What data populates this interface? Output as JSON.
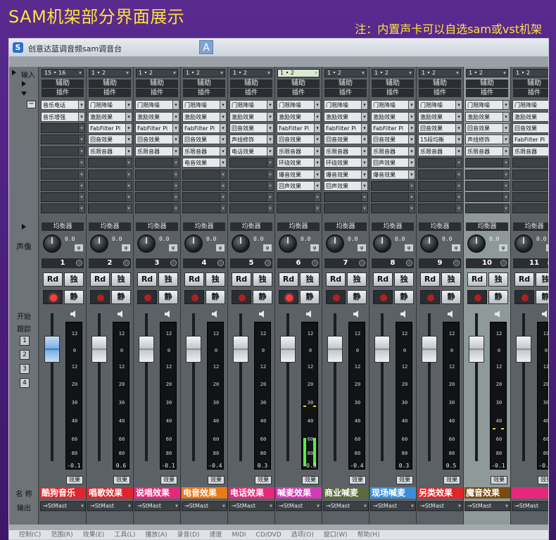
{
  "headline": "SAM机架部分界面展示",
  "note": "注：内置声卡可以自选sam或vst机架",
  "window": {
    "icon_letter": "S",
    "title": "创意达蓝调音频sam调音台"
  },
  "left_labels": {
    "input": "输入",
    "pan": "声像",
    "start": "开始",
    "track": "跟踪",
    "buttons": [
      "1",
      "2",
      "3",
      "4"
    ],
    "name": "名 称",
    "output": "输出"
  },
  "common": {
    "aux": "辅助",
    "plugins": "插件",
    "eq": "均衡器",
    "rd": "Rd",
    "solo": "独",
    "mute": "静",
    "fx": "效果",
    "output": "StMast",
    "pan_value": "0.0",
    "phase": "φ",
    "scale": [
      "12",
      "0",
      "12",
      "20",
      "30",
      "40",
      "60",
      "80"
    ]
  },
  "channels": [
    {
      "number": "1",
      "input": "15 • 16",
      "name": "酷狗音乐",
      "name_color": "#e0252b",
      "volume": "-0.1",
      "fader_pos": 0.17,
      "meter": 0,
      "selected": false,
      "rec": true,
      "blue": true,
      "slots": [
        "音乐电话",
        "音乐增强",
        "",
        "",
        "",
        "",
        "",
        "",
        "",
        ""
      ]
    },
    {
      "number": "2",
      "input": "1 • 2",
      "name": "唱歌效果",
      "name_color": "#e0252b",
      "volume": "0.6",
      "fader_pos": 0.17,
      "meter": 0,
      "selected": false,
      "rec": false,
      "blue": false,
      "slots": [
        "门限降噪",
        "激励效果",
        "FabFilter Pi",
        "回音效果",
        "乐限音器",
        "",
        "",
        "",
        "",
        ""
      ]
    },
    {
      "number": "3",
      "input": "1 • 2",
      "name": "说唱效果",
      "name_color": "#e6287a",
      "volume": "-0.1",
      "fader_pos": 0.17,
      "meter": 0,
      "selected": false,
      "rec": false,
      "blue": false,
      "slots": [
        "门限降噪",
        "激励效果",
        "FabFilter Pi",
        "回音效果",
        "乐限音器",
        "",
        "",
        "",
        "",
        ""
      ]
    },
    {
      "number": "4",
      "input": "1 • 2",
      "name": "电音效果",
      "name_color": "#ea7a16",
      "volume": "-0.4",
      "fader_pos": 0.17,
      "meter": 0,
      "selected": false,
      "rec": false,
      "blue": false,
      "slots": [
        "门限降噪",
        "激励效果",
        "FabFilter Pi",
        "回音效果",
        "乐限音器",
        "电音效果",
        "",
        "",
        "",
        ""
      ]
    },
    {
      "number": "5",
      "input": "1 • 2",
      "name": "电话效果",
      "name_color": "#e6287a",
      "volume": "0.3",
      "fader_pos": 0.17,
      "meter": 0,
      "selected": false,
      "rec": false,
      "blue": false,
      "slots": [
        "门限降噪",
        "激励效果",
        "回音效果",
        "声线修饰",
        "电话效果",
        "",
        "",
        "",
        "",
        ""
      ]
    },
    {
      "number": "6",
      "input": "1 • 2",
      "name": "喊麦效果",
      "name_color": "#d33ab5",
      "volume": "-0.3",
      "fader_pos": 0.17,
      "meter": 0.35,
      "selected": false,
      "rec": true,
      "blue": false,
      "slots": [
        "门限降噪",
        "激励效果",
        "FabFilter Pi",
        "回音效果",
        "乐限音器",
        "环绕效果",
        "爆音效果",
        "回声效果",
        "",
        ""
      ]
    },
    {
      "number": "7",
      "input": "1 • 2",
      "name": "商业喊麦",
      "name_color": "#5b6a3a",
      "volume": "-0.4",
      "fader_pos": 0.17,
      "meter": 0,
      "selected": false,
      "rec": false,
      "blue": false,
      "slots": [
        "门限降噪",
        "激励效果",
        "FabFilter Pi",
        "回音效果",
        "乐限音器",
        "环绕效果",
        "爆音效果",
        "回声效果",
        "",
        ""
      ]
    },
    {
      "number": "8",
      "input": "1 • 2",
      "name": "现场喊麦",
      "name_color": "#3a8fd8",
      "volume": "0.3",
      "fader_pos": 0.17,
      "meter": 0,
      "selected": false,
      "rec": false,
      "blue": false,
      "slots": [
        "门限降噪",
        "激励效果",
        "FabFilter Pi",
        "回音效果",
        "乐限音器",
        "回声效果",
        "爆音效果",
        "",
        "",
        ""
      ]
    },
    {
      "number": "9",
      "input": "1 • 2",
      "name": "另类效果",
      "name_color": "#e0252b",
      "volume": "0.5",
      "fader_pos": 0.17,
      "meter": 0,
      "selected": false,
      "rec": false,
      "blue": false,
      "slots": [
        "门限降噪",
        "激励效果",
        "回音效果",
        "15段均衡",
        "乐限音器",
        "",
        "",
        "",
        "",
        ""
      ]
    },
    {
      "number": "10",
      "input": "1 • 2",
      "name": "魔音效果",
      "name_color": "#7a4a12",
      "volume": "-0.1",
      "fader_pos": 0.17,
      "meter": 0,
      "selected": true,
      "rec": false,
      "blue": false,
      "slots": [
        "门限降噪",
        "激励效果",
        "回音效果",
        "声线修饰",
        "乐限音器",
        "",
        "",
        "",
        "",
        ""
      ]
    },
    {
      "number": "11",
      "input": "1 • 2",
      "name": "",
      "name_color": "#e6287a",
      "volume": "-0.2",
      "fader_pos": 0.17,
      "meter": 0,
      "selected": false,
      "rec": false,
      "blue": false,
      "slots": [
        "门限降噪",
        "激励效果",
        "回音效果",
        "FabFilter Pi",
        "乐限音器",
        "",
        "",
        "",
        "",
        ""
      ]
    }
  ],
  "menu": [
    "控制(C)",
    "范围(R)",
    "效果(E)",
    "工具(L)",
    "播放(A)",
    "录音(D)",
    "速度",
    "MIDI",
    "CD/DVD",
    "选项(O)",
    "窗口(W)",
    "帮助(H)"
  ]
}
